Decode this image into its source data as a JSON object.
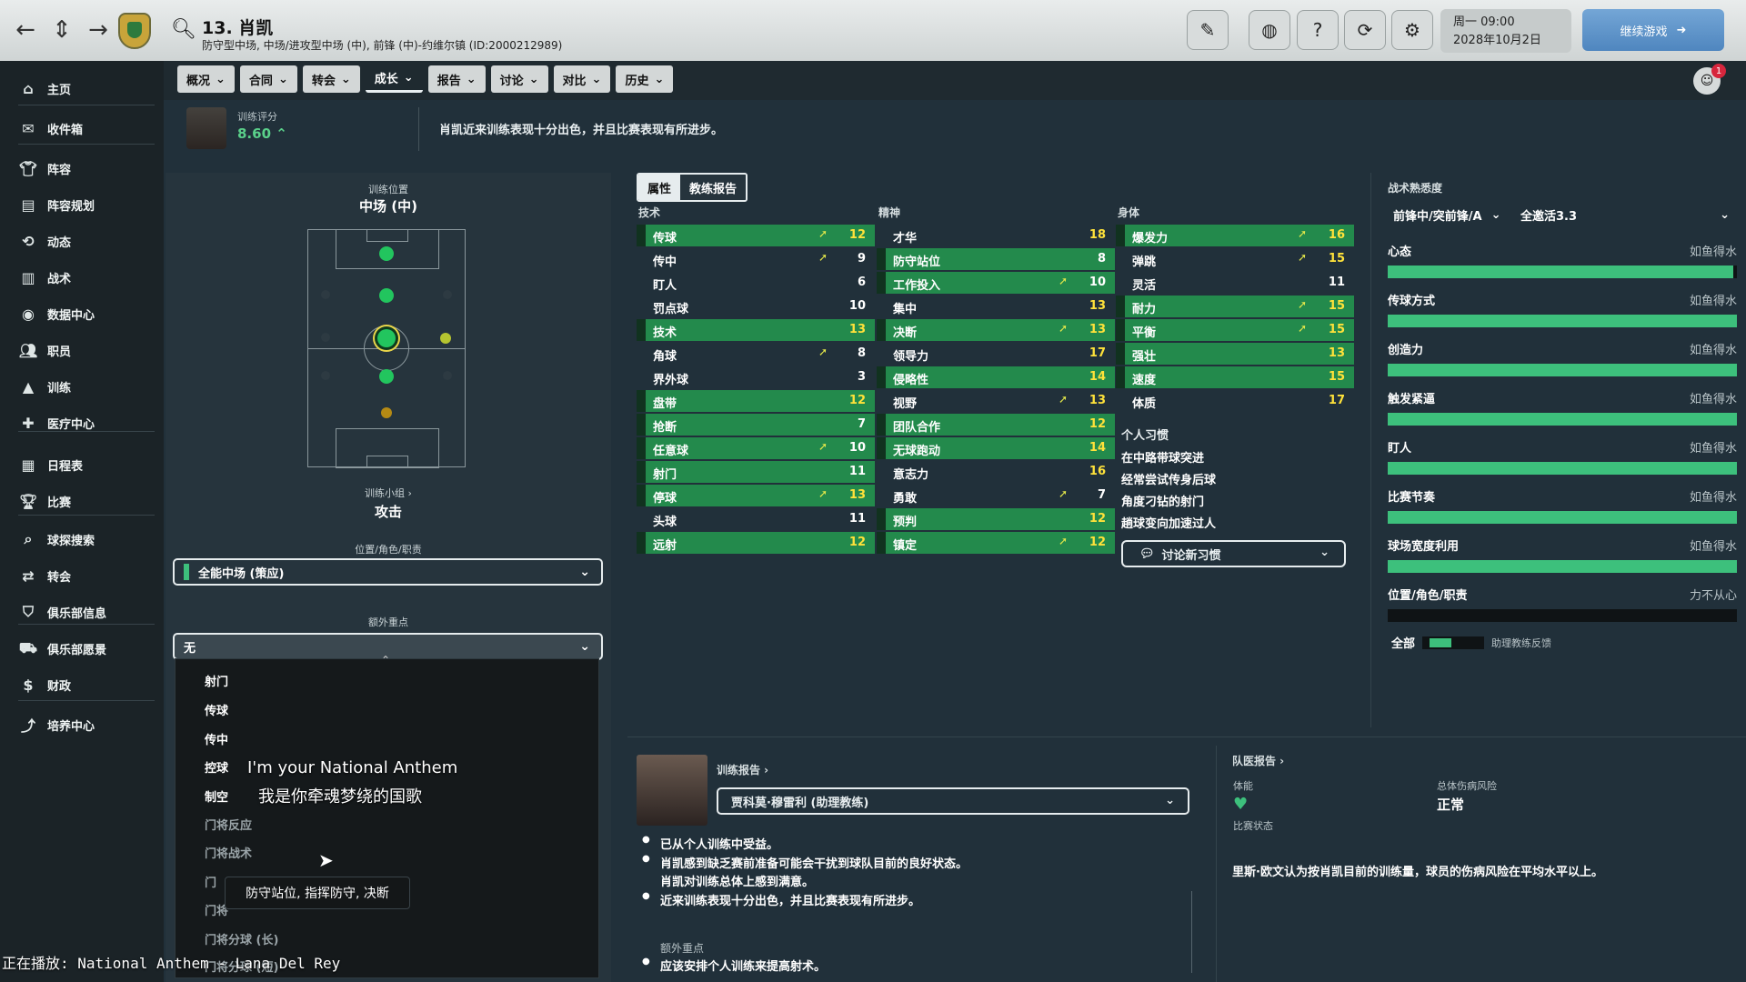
{
  "header": {
    "player_title": "13. 肖凯",
    "player_subtitle": "防守型中场, 中场/进攻型中场 (中), 前锋 (中)-约维尔镇 (ID:2000212989)",
    "date_line1": "周一 09:00",
    "date_line2": "2028年10月2日",
    "continue_label": "继续游戏",
    "message_count": "1"
  },
  "sidebar": {
    "items": [
      {
        "label": "主页",
        "icon": "home-icon"
      },
      {
        "label": "收件箱",
        "icon": "inbox-icon"
      },
      {
        "label": "阵容",
        "icon": "shirt-icon"
      },
      {
        "label": "阵容规划",
        "icon": "clipboard-icon"
      },
      {
        "label": "动态",
        "icon": "refresh-icon"
      },
      {
        "label": "战术",
        "icon": "tactics-icon"
      },
      {
        "label": "数据中心",
        "icon": "data-icon"
      },
      {
        "label": "职员",
        "icon": "staff-icon"
      },
      {
        "label": "训练",
        "icon": "training-icon"
      },
      {
        "label": "医疗中心",
        "icon": "medical-icon"
      },
      {
        "label": "日程表",
        "icon": "calendar-icon"
      },
      {
        "label": "比赛",
        "icon": "trophy-icon"
      },
      {
        "label": "球探搜索",
        "icon": "search-icon"
      },
      {
        "label": "转会",
        "icon": "transfer-icon"
      },
      {
        "label": "俱乐部信息",
        "icon": "shield-icon"
      },
      {
        "label": "俱乐部愿景",
        "icon": "vision-icon"
      },
      {
        "label": "财政",
        "icon": "finance-icon"
      },
      {
        "label": "培养中心",
        "icon": "development-icon"
      }
    ]
  },
  "subtabs": [
    "概况",
    "合同",
    "转会",
    "成长",
    "报告",
    "讨论",
    "对比",
    "历史"
  ],
  "training_rating": {
    "label": "训练评分",
    "value": "8.60",
    "summary": "肖凯近来训练表现十分出色，并且比赛表现有所进步。"
  },
  "training_position": {
    "label": "训练位置",
    "value": "中场 (中)",
    "group_label": "训练小组 ›",
    "group_value": "攻击",
    "role_label": "位置/角色/职责",
    "role_value": "全能中场 (策应)",
    "focus_label": "额外重点",
    "focus_value": "无"
  },
  "focus_dropdown": {
    "options": [
      "射门",
      "传球",
      "传中",
      "控球",
      "制空",
      "门将反应",
      "门将战术",
      "门",
      "门将",
      "门将分球 (长)",
      "门将分球 (短)"
    ],
    "tooltip": "防守站位, 指挥防守, 决断"
  },
  "overlay": {
    "lyric_en": "I'm your National Anthem",
    "lyric_zh": "我是你牵魂梦绕的国歌",
    "now_playing": "正在播放: National Anthem - Lana Del Rey"
  },
  "attributes": {
    "tab_attr": "属性",
    "tab_report": "教练报告",
    "technical_head": "技术",
    "mental_head": "精神",
    "physical_head": "身体",
    "technical": [
      {
        "name": "传球",
        "value": "12",
        "hl": true,
        "arrow": true
      },
      {
        "name": "传中",
        "value": "9",
        "hl": false,
        "arrow": true
      },
      {
        "name": "盯人",
        "value": "6",
        "hl": false,
        "arrow": false
      },
      {
        "name": "罚点球",
        "value": "10",
        "hl": false,
        "arrow": false
      },
      {
        "name": "技术",
        "value": "13",
        "hl": true,
        "arrow": false
      },
      {
        "name": "角球",
        "value": "8",
        "hl": false,
        "arrow": true
      },
      {
        "name": "界外球",
        "value": "3",
        "hl": false,
        "arrow": false
      },
      {
        "name": "盘带",
        "value": "12",
        "hl": true,
        "arrow": false
      },
      {
        "name": "抢断",
        "value": "7",
        "hl": true,
        "arrow": false
      },
      {
        "name": "任意球",
        "value": "10",
        "hl": true,
        "arrow": true
      },
      {
        "name": "射门",
        "value": "11",
        "hl": true,
        "arrow": false
      },
      {
        "name": "停球",
        "value": "13",
        "hl": true,
        "arrow": true
      },
      {
        "name": "头球",
        "value": "11",
        "hl": false,
        "arrow": false
      },
      {
        "name": "远射",
        "value": "12",
        "hl": true,
        "arrow": false
      }
    ],
    "mental": [
      {
        "name": "才华",
        "value": "18",
        "hl": false,
        "arrow": false
      },
      {
        "name": "防守站位",
        "value": "8",
        "hl": true,
        "arrow": false
      },
      {
        "name": "工作投入",
        "value": "10",
        "hl": true,
        "arrow": true
      },
      {
        "name": "集中",
        "value": "13",
        "hl": false,
        "arrow": false
      },
      {
        "name": "决断",
        "value": "13",
        "hl": true,
        "arrow": true
      },
      {
        "name": "领导力",
        "value": "17",
        "hl": false,
        "arrow": false
      },
      {
        "name": "侵略性",
        "value": "14",
        "hl": true,
        "arrow": false
      },
      {
        "name": "视野",
        "value": "13",
        "hl": false,
        "arrow": true
      },
      {
        "name": "团队合作",
        "value": "12",
        "hl": true,
        "arrow": false
      },
      {
        "name": "无球跑动",
        "value": "14",
        "hl": true,
        "arrow": false
      },
      {
        "name": "意志力",
        "value": "16",
        "hl": false,
        "arrow": false
      },
      {
        "name": "勇敢",
        "value": "7",
        "hl": false,
        "arrow": true
      },
      {
        "name": "预判",
        "value": "12",
        "hl": true,
        "arrow": false
      },
      {
        "name": "镇定",
        "value": "12",
        "hl": true,
        "arrow": true
      }
    ],
    "physical": [
      {
        "name": "爆发力",
        "value": "16",
        "hl": true,
        "arrow": true
      },
      {
        "name": "弹跳",
        "value": "15",
        "hl": false,
        "arrow": true
      },
      {
        "name": "灵活",
        "value": "11",
        "hl": false,
        "arrow": false
      },
      {
        "name": "耐力",
        "value": "15",
        "hl": true,
        "arrow": true
      },
      {
        "name": "平衡",
        "value": "15",
        "hl": true,
        "arrow": true
      },
      {
        "name": "强壮",
        "value": "13",
        "hl": true,
        "arrow": false
      },
      {
        "name": "速度",
        "value": "15",
        "hl": true,
        "arrow": false
      },
      {
        "name": "体质",
        "value": "17",
        "hl": false,
        "arrow": false
      }
    ],
    "habits_title": "个人习惯",
    "habits": [
      "在中路带球突进",
      "经常尝试传身后球",
      "角度刁钻的射门",
      "趟球变向加速过人"
    ],
    "discuss_habits": "讨论新习惯"
  },
  "tactical": {
    "title": "战术熟悉度",
    "role_select": "前锋中/突前锋/A",
    "plan_select": "全邀活3.3",
    "items": [
      {
        "name": "心态",
        "status": "如鱼得水",
        "level": 0.99
      },
      {
        "name": "传球方式",
        "status": "如鱼得水",
        "level": 1
      },
      {
        "name": "创造力",
        "status": "如鱼得水",
        "level": 1
      },
      {
        "name": "触发紧逼",
        "status": "如鱼得水",
        "level": 1
      },
      {
        "name": "盯人",
        "status": "如鱼得水",
        "level": 1
      },
      {
        "name": "比赛节奏",
        "status": "如鱼得水",
        "level": 1
      },
      {
        "name": "球场宽度利用",
        "status": "如鱼得水",
        "level": 1
      },
      {
        "name": "位置/角色/职责",
        "status": "力不从心",
        "level": 0
      }
    ],
    "legend_all": "全部",
    "legend_sub": "助理教练反馈"
  },
  "coach_report": {
    "head": "训练报告 ›",
    "coach": "贾科莫·穆雷利 (助理教练)",
    "bullets": [
      "已从个人训练中受益。",
      "肖凯感到缺乏赛前准备可能会干扰到球队目前的良好状态。",
      "肖凯对训练总体上感到满意。",
      "近来训练表现十分出色，并且比赛表现有所进步。"
    ],
    "extra_label": "额外重点",
    "extra_bullet": "应该安排个人训练来提高射术。"
  },
  "medical": {
    "head": "队医报告 ›",
    "fitness_label": "体能",
    "match_label": "比赛状态",
    "risk_label": "总体伤病风险",
    "risk_value": "正常",
    "text": "里斯·欧文认为按肖凯目前的训练量，球员的伤病风险在平均水平以上。"
  }
}
